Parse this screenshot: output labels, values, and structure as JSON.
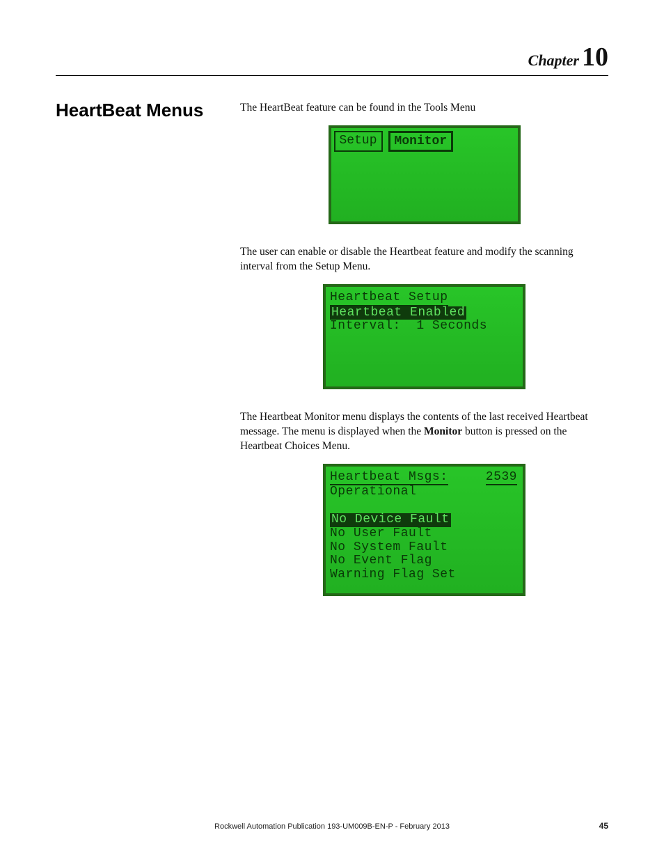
{
  "chapter": {
    "word": "Chapter",
    "number": "10"
  },
  "section_title": "HeartBeat Menus",
  "para1": "The HeartBeat feature can be found in the Tools Menu",
  "lcd1": {
    "tab_setup": "Setup",
    "tab_monitor": "Monitor"
  },
  "para2": "The user can enable or disable the Heartbeat feature and modify the scanning interval from the Setup Menu.",
  "lcd2": {
    "title": "Heartbeat Setup",
    "row_enabled": "Heartbeat Enabled",
    "row_interval_label": "Interval:",
    "row_interval_value": "  1 Seconds"
  },
  "para3_pre": "The Heartbeat Monitor menu displays the contents of the last received Heartbeat message. The menu is displayed when the ",
  "para3_bold": "Monitor",
  "para3_post": " button is pressed on the Heartbeat Choices Menu.",
  "lcd3": {
    "header_label": "Heartbeat Msgs:",
    "header_count": "2539",
    "status": "Operational",
    "line1": "No Device Fault",
    "line2": "No User Fault",
    "line3": "No System Fault",
    "line4": "No Event Flag",
    "line5": "Warning Flag Set"
  },
  "footer": {
    "pubinfo": "Rockwell Automation Publication 193-UM009B-EN-P - February 2013",
    "pagenum": "45"
  }
}
